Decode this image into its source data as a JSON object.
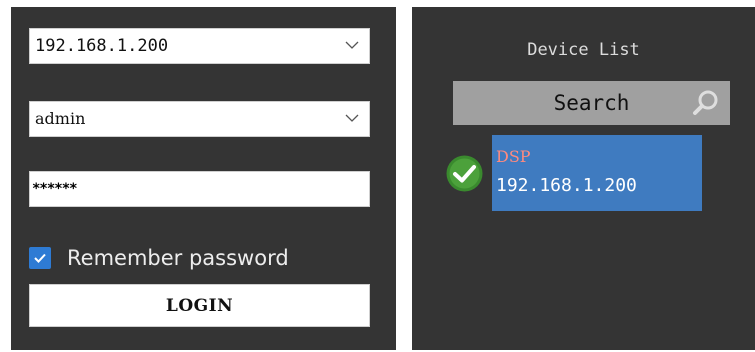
{
  "login": {
    "ip_address": "192.168.1.200",
    "username": "admin",
    "password_mask": "******",
    "remember_label": "Remember password",
    "remember_checked": true,
    "login_label": "LOGIN"
  },
  "device_list": {
    "title": "Device List",
    "search_label": "Search",
    "devices": [
      {
        "name": "DSP",
        "ip": "192.168.1.200",
        "status": "connected"
      }
    ]
  },
  "colors": {
    "panel_bg": "#343434",
    "accent_blue": "#3f7bc0",
    "checkbox_blue": "#2e7bd4",
    "status_green": "#3a8a2e",
    "device_name": "#ff8a7e"
  },
  "icons": {
    "dropdown": "chevron-down-icon",
    "search": "magnifier-icon",
    "status": "check-circle-icon",
    "checkbox": "checkmark-icon"
  }
}
